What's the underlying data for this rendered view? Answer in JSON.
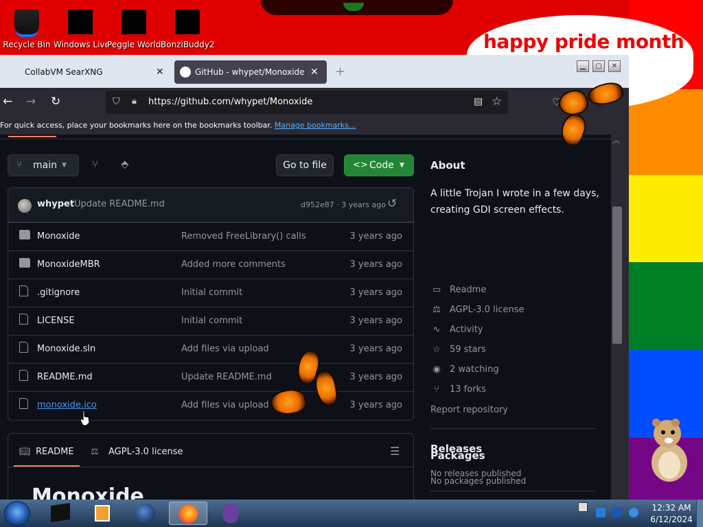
{
  "desktop": {
    "icons": [
      {
        "label": "Recycle Bin",
        "icon": "recycle-bin-icon"
      },
      {
        "label": "Windows Live Mail",
        "icon": "windows-live-mail-icon"
      },
      {
        "label": "Peggle World of Warcraft",
        "icon": "peggle-icon"
      },
      {
        "label": "BonziBuddy2",
        "icon": "bonzibuddy-icon"
      }
    ],
    "bubble_text": "happy pride month",
    "stripe_colors": [
      "#ff0000",
      "#ff8c00",
      "#ffed00",
      "#008026",
      "#004dff",
      "#750787"
    ]
  },
  "browser": {
    "tabs": [
      {
        "title": "CollabVM SearXNG",
        "close": "✕"
      },
      {
        "title": "GitHub - whypet/Monoxide: A little Trojan I wrote in a few days",
        "close": "✕"
      }
    ],
    "new_tab": "+",
    "url": "https://github.com/whypet/Monoxide",
    "bookmarks_text": "For quick access, place your bookmarks here on the bookmarks toolbar.",
    "bookmarks_link": "Manage bookmarks..."
  },
  "repo": {
    "branch": "main",
    "goto_file": "Go to file",
    "code_button": "Code",
    "commit": {
      "author": "whypet",
      "message": "Update README.md",
      "meta": "d952e87 · 3 years ago"
    },
    "files": [
      {
        "name": "Monoxide",
        "type": "dir",
        "message": "Removed FreeLibrary() calls",
        "age": "3 years ago"
      },
      {
        "name": "MonoxideMBR",
        "type": "dir",
        "message": "Added more comments",
        "age": "3 years ago"
      },
      {
        "name": ".gitignore",
        "type": "file",
        "message": "Initial commit",
        "age": "3 years ago"
      },
      {
        "name": "LICENSE",
        "type": "file",
        "message": "Initial commit",
        "age": "3 years ago"
      },
      {
        "name": "Monoxide.sln",
        "type": "file",
        "message": "Add files via upload",
        "age": "3 years ago"
      },
      {
        "name": "README.md",
        "type": "file",
        "message": "Update README.md",
        "age": "3 years ago"
      },
      {
        "name": "monoxide.ico",
        "type": "file",
        "message": "Add files via upload",
        "age": "3 years ago"
      }
    ],
    "readme_tabs": {
      "readme": "README",
      "license": "AGPL-3.0 license"
    },
    "readme_heading": "Monoxide"
  },
  "about": {
    "title": "About",
    "description": "A little Trojan I wrote in a few days, creating GDI screen effects.",
    "items": [
      {
        "label": "Readme",
        "icon": "book-icon"
      },
      {
        "label": "AGPL-3.0 license",
        "icon": "law-icon"
      },
      {
        "label": "Activity",
        "icon": "pulse-icon"
      },
      {
        "label": "59 stars",
        "icon": "star-icon"
      },
      {
        "label": "2 watching",
        "icon": "eye-icon"
      },
      {
        "label": "13 forks",
        "icon": "fork-icon"
      }
    ],
    "report": "Report repository",
    "releases_title": "Releases",
    "releases_text": "No releases published",
    "packages_title": "Packages",
    "packages_text": "No packages published"
  },
  "taskbar": {
    "apps": [
      "terminal-app-icon",
      "media-player-icon",
      "globe-app-icon",
      "firefox-icon",
      "bonzibuddy-icon"
    ],
    "time": "12:32 AM",
    "date": "6/12/2024"
  }
}
